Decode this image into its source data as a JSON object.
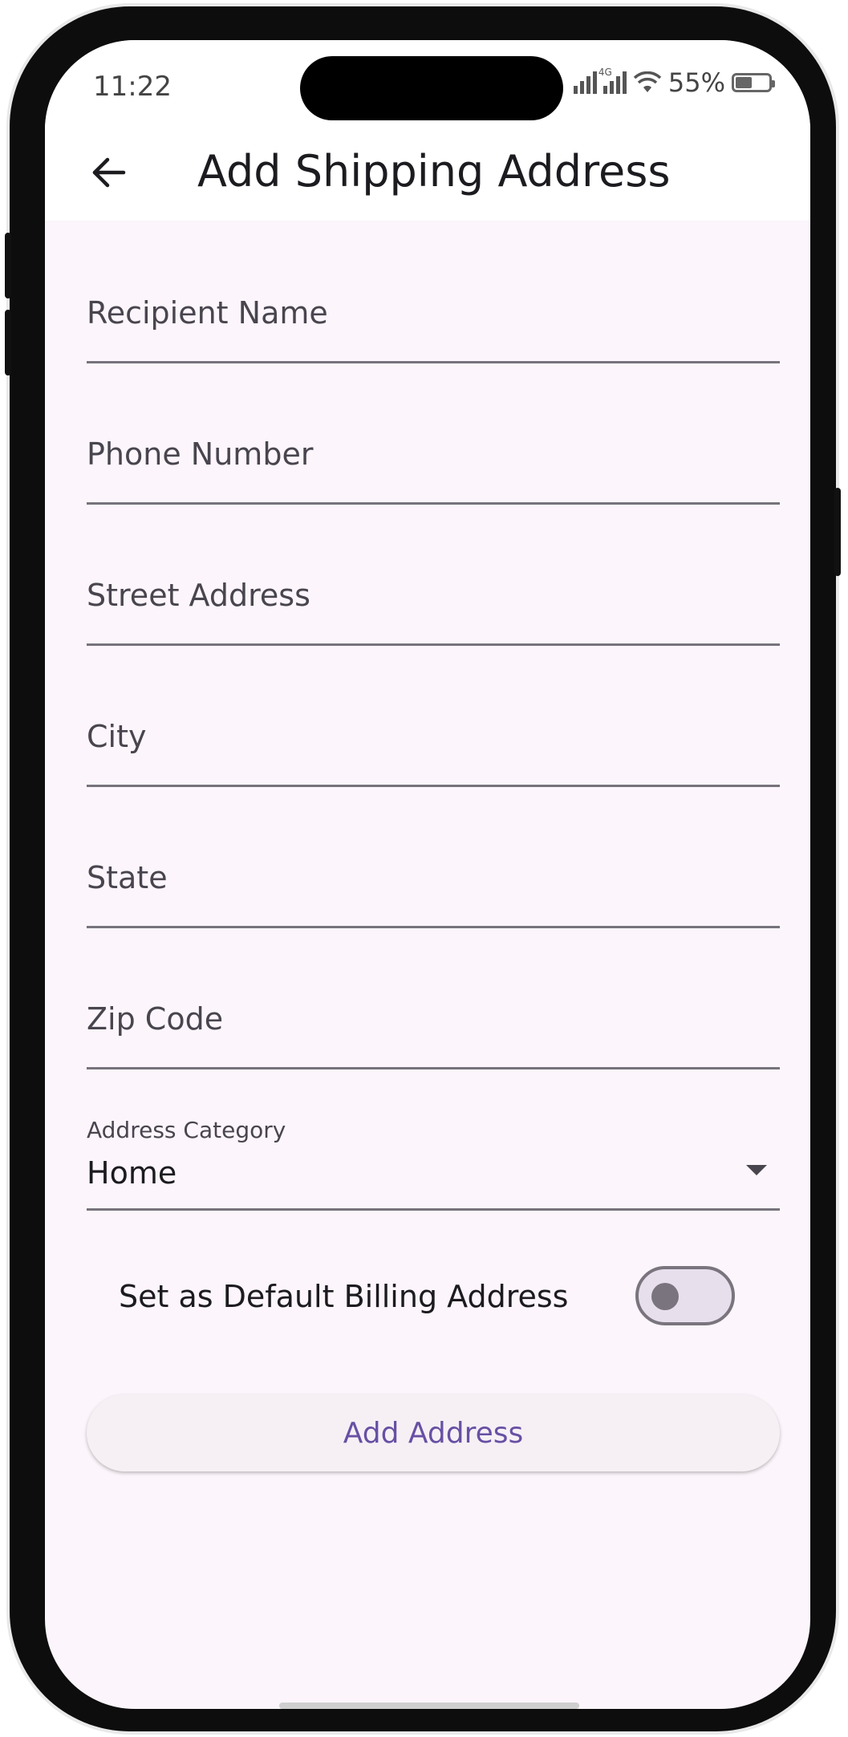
{
  "status_bar": {
    "time": "11:22",
    "network_label": "4G",
    "battery": "55%",
    "battery_level": 0.55
  },
  "app_bar": {
    "title": "Add Shipping Address",
    "back_icon": "arrow-left-icon"
  },
  "form": {
    "recipient_name": {
      "placeholder": "Recipient Name",
      "value": ""
    },
    "phone_number": {
      "placeholder": "Phone Number",
      "value": ""
    },
    "street_address": {
      "placeholder": "Street Address",
      "value": ""
    },
    "city": {
      "placeholder": "City",
      "value": ""
    },
    "state": {
      "placeholder": "State",
      "value": ""
    },
    "zip_code": {
      "placeholder": "Zip Code",
      "value": ""
    },
    "address_category": {
      "label": "Address Category",
      "selected": "Home"
    },
    "default_billing": {
      "label": "Set as Default Billing Address",
      "enabled": false
    }
  },
  "actions": {
    "add_address_label": "Add Address"
  },
  "colors": {
    "background": "#fcf5fb",
    "primary": "#6750a4",
    "outline": "#79747e",
    "text": "#1c1b1f"
  }
}
